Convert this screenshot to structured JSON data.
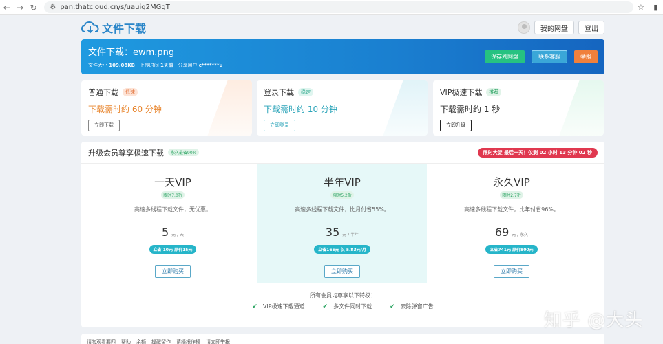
{
  "browser": {
    "url": "pan.thatcloud.cn/s/uauiq2MGgT"
  },
  "header": {
    "logo_text": "文件下载",
    "my_drive": "我的网盘",
    "logout": "登出"
  },
  "banner": {
    "title": "文件下载：ewm.png",
    "size_label": "文件大小",
    "size_value": "109.08KB",
    "upload_label": "上传时间",
    "upload_value": "1天前",
    "sharer_label": "分享用户",
    "sharer_value": "c*******u",
    "save_btn": "保存到网盘",
    "contact_btn": "联系客服",
    "report_btn": "举报"
  },
  "options": [
    {
      "title": "普通下载",
      "tag": "低速",
      "time": "下载需时约 60 分钟",
      "button": "立即下载"
    },
    {
      "title": "登录下载",
      "tag": "稳定",
      "time": "下载需时约 10 分钟",
      "button": "立即登录"
    },
    {
      "title": "VIP极速下载",
      "tag": "推荐",
      "time": "下载需时约 1 秒",
      "button": "立即升级"
    }
  ],
  "vip": {
    "title": "升级会员尊享极速下载",
    "tag": "永久最省90%",
    "countdown": "限时大促 最后一天！仅剩 02 小时 13 分钟 02 秒",
    "plans": [
      {
        "name": "一天VIP",
        "badge": "限时7.0折",
        "desc": "高速多线程下载文件，无优惠。",
        "price": "5",
        "unit": "元 / 天",
        "save": "立省 10元 原价15元",
        "buy": "立即购买"
      },
      {
        "name": "半年VIP",
        "badge": "限时5.2折",
        "desc": "高速多线程下载文件，比月付省55%。",
        "price": "35",
        "unit": "元 / 半年",
        "save": "立省165元 仅 5.83元/月",
        "buy": "立即购买"
      },
      {
        "name": "永久VIP",
        "badge": "限时2.7折",
        "desc": "高速多线程下载文件，比年付省96%。",
        "price": "69",
        "unit": "元 / 永久",
        "save": "立省741元 原价800元",
        "buy": "立即购买"
      }
    ],
    "perks_title": "所有会员均尊享以下特权：",
    "perks": [
      "VIP极速下载通道",
      "多文件同时下载",
      "去除弹窗广告"
    ]
  },
  "footer": {
    "links": [
      "请勿观看要四",
      "帮助",
      "余额",
      "提醒留作",
      "请播报作播",
      "请立即举报"
    ]
  },
  "watermark": "知乎 @大头"
}
